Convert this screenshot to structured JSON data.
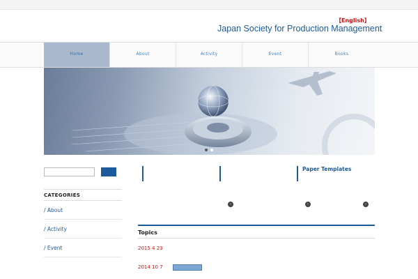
{
  "topbar": {
    "text": ""
  },
  "header": {
    "site_title": "",
    "english_link": "English",
    "english_title": "Japan Society for Production Management"
  },
  "nav": {
    "items": [
      {
        "jp": "",
        "en": "Home"
      },
      {
        "jp": "",
        "en": "About"
      },
      {
        "jp": "",
        "en": "Activity"
      },
      {
        "jp": "",
        "en": "Event"
      },
      {
        "jp": "",
        "en": "Books"
      }
    ]
  },
  "search": {
    "value": "",
    "button_label": ""
  },
  "sidebar": {
    "categories_label": "CATEGORIES",
    "items": [
      {
        "jp": "",
        "en": " / About"
      },
      {
        "jp": "",
        "en": " / Activity"
      },
      {
        "jp": "",
        "en": " / Event"
      },
      {
        "jp": "",
        "en": ""
      }
    ]
  },
  "boxes": [
    {
      "title": "",
      "text": "",
      "more": ""
    },
    {
      "title": "",
      "text": "",
      "more": ""
    },
    {
      "title": "Paper Templates",
      "text": "",
      "more": ""
    }
  ],
  "topics": {
    "heading": "Topics",
    "entries": [
      {
        "date": "2015 4 23",
        "text": ""
      },
      {
        "date": "2014 10 7",
        "text": ""
      }
    ]
  },
  "colors": {
    "accent": "#1d5a9b",
    "date": "#cc1111",
    "nav_active": "#a9b8cc"
  }
}
